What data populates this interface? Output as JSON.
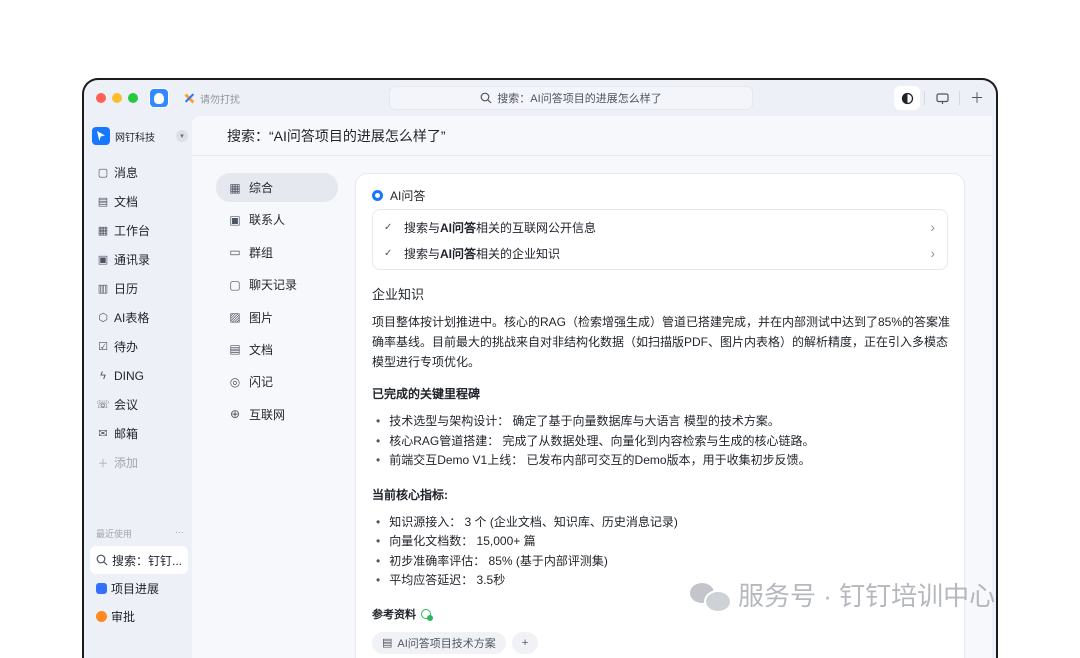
{
  "titlebar": {
    "dnd_label": "请勿打扰",
    "search_text": "搜索：AI问答项目的进展怎么样了"
  },
  "sidebar": {
    "org_name": "网钉科技",
    "items": [
      {
        "label": "消息",
        "icon": "message-icon"
      },
      {
        "label": "文档",
        "icon": "document-icon"
      },
      {
        "label": "工作台",
        "icon": "grid-icon"
      },
      {
        "label": "通讯录",
        "icon": "contacts-icon"
      },
      {
        "label": "日历",
        "icon": "calendar-icon"
      },
      {
        "label": "AI表格",
        "icon": "ai-table-icon"
      },
      {
        "label": "待办",
        "icon": "todo-icon"
      },
      {
        "label": "DING",
        "icon": "ding-icon"
      },
      {
        "label": "会议",
        "icon": "meeting-icon"
      },
      {
        "label": "邮箱",
        "icon": "mail-icon"
      },
      {
        "label": "添加",
        "icon": "plus-icon"
      }
    ],
    "recent_label": "最近使用",
    "recent_more": "···",
    "recent": [
      {
        "label": "搜索：钉钉..."
      },
      {
        "label": "项目进展"
      },
      {
        "label": "审批"
      }
    ]
  },
  "main": {
    "title": "搜索：“AI问答项目的进展怎么样了”",
    "filters": [
      {
        "label": "综合",
        "icon": "grid-icon"
      },
      {
        "label": "联系人",
        "icon": "contact-card-icon"
      },
      {
        "label": "群组",
        "icon": "group-icon"
      },
      {
        "label": "聊天记录",
        "icon": "chat-history-icon"
      },
      {
        "label": "图片",
        "icon": "image-icon"
      },
      {
        "label": "文档",
        "icon": "document-icon"
      },
      {
        "label": "闪记",
        "icon": "flash-note-icon"
      },
      {
        "label": "互联网",
        "icon": "globe-icon"
      }
    ]
  },
  "result": {
    "ai_label": "AI问答",
    "steps": [
      {
        "pre": "搜索与",
        "bold": "AI问答",
        "post": "相关的互联网公开信息"
      },
      {
        "pre": "搜索与",
        "bold": "AI问答",
        "post": "相关的企业知识"
      }
    ],
    "section_title": "企业知识",
    "summary": "项目整体按计划推进中。核心的RAG（检索增强生成）管道已搭建完成，并在内部测试中达到了85%的答案准确率基线。目前最大的挑战来自对非结构化数据（如扫描版PDF、图片内表格）的解析精度，正在引入多模态模型进行专项优化。",
    "milestones_title": "已完成的关键里程碑",
    "milestones": [
      "技术选型与架构设计： 确定了基于向量数据库与大语言    模型的技术方案。",
      "核心RAG管道搭建： 完成了从数据处理、向量化到内容检索与生成的核心链路。",
      "前端交互Demo V1上线： 已发布内部可交互的Demo版本，用于收集初步反馈。"
    ],
    "metrics_title": "当前核心指标:",
    "metrics": [
      "知识源接入： 3 个 (企业文档、知识库、历史消息记录)",
      "向量化文档数： 15,000+ 篇",
      "初步准确率评估： 85% (基于内部评测集)",
      "平均应答延迟： 3.5秒"
    ],
    "refs_title": "参考资料",
    "ref_chip": "AI问答项目技术方案"
  },
  "watermark": "服务号 · 钉钉培训中心"
}
